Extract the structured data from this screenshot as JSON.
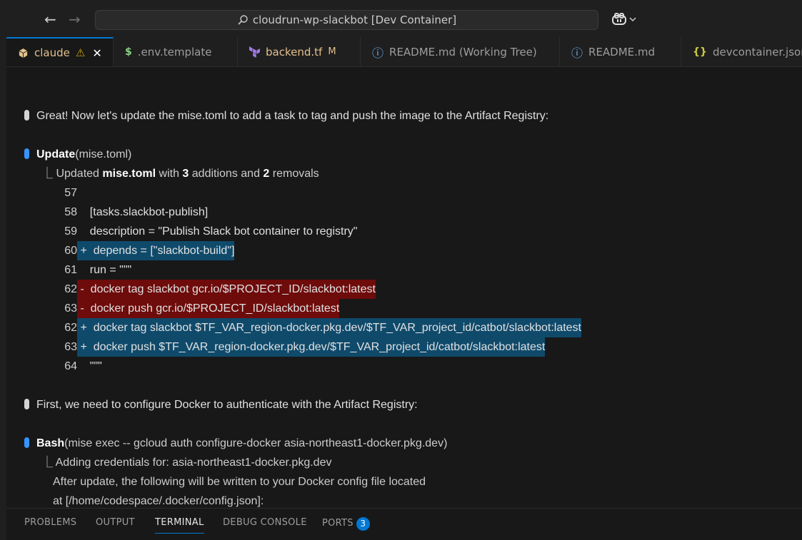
{
  "titlebar": {
    "search_text": "cloudrun-wp-slackbot [Dev Container]",
    "back_icon": "←",
    "forward_icon": "→"
  },
  "tabs": [
    {
      "label": "claude",
      "icon": "cube-icon",
      "warning": "⚠",
      "close": "✕",
      "active": true
    },
    {
      "label": ".env.template",
      "icon": "$"
    },
    {
      "label": "backend.tf",
      "icon": "terraform-icon",
      "badge": "M"
    },
    {
      "label": "README.md (Working Tree)",
      "icon": "ⓘ"
    },
    {
      "label": "README.md",
      "icon": "ⓘ"
    },
    {
      "label": "devcontainer.json",
      "icon": "{}"
    }
  ],
  "terminal": {
    "msg1": "Great! Now let's update the mise.toml to add a task to tag and push the image to the Artifact Registry:",
    "update_tool": "Update",
    "update_arg": "(mise.toml)",
    "updated_prefix": "Updated ",
    "updated_file": "mise.toml",
    "updated_with": " with ",
    "additions": "3",
    "additions_text": " additions and ",
    "removals": "2",
    "removals_text": " removals",
    "diff": [
      {
        "num": "57",
        "sign": " ",
        "text": "",
        "kind": "ctx"
      },
      {
        "num": "58",
        "sign": " ",
        "text": "[tasks.slackbot-publish]",
        "kind": "ctx"
      },
      {
        "num": "59",
        "sign": " ",
        "text": "description = \"Publish Slack bot container to registry\"",
        "kind": "ctx"
      },
      {
        "num": "60",
        "sign": "+",
        "text": "depends = [\"slackbot-build\"]",
        "kind": "add"
      },
      {
        "num": "61",
        "sign": " ",
        "text": "run = \"\"\"",
        "kind": "ctx"
      },
      {
        "num": "62",
        "sign": "-",
        "text": "docker tag slackbot gcr.io/$PROJECT_ID/slackbot:latest",
        "kind": "del"
      },
      {
        "num": "63",
        "sign": "-",
        "text": "docker push gcr.io/$PROJECT_ID/slackbot:latest",
        "kind": "del"
      },
      {
        "num": "62",
        "sign": "+",
        "text": "docker tag slackbot $TF_VAR_region-docker.pkg.dev/$TF_VAR_project_id/catbot/slackbot:latest",
        "kind": "add"
      },
      {
        "num": "63",
        "sign": "+",
        "text": "docker push $TF_VAR_region-docker.pkg.dev/$TF_VAR_project_id/catbot/slackbot:latest",
        "kind": "add"
      },
      {
        "num": "64",
        "sign": " ",
        "text": "\"\"\"",
        "kind": "ctx"
      }
    ],
    "msg2": "First, we need to configure Docker to authenticate with the Artifact Registry:",
    "bash_tool": "Bash",
    "bash_arg": "(mise exec -- gcloud auth configure-docker asia-northeast1-docker.pkg.dev)",
    "out1": "Adding credentials for: asia-northeast1-docker.pkg.dev",
    "out2": "After update, the following will be written to your Docker config file located",
    "out3": "at [/home/codespace/.docker/config.json]:"
  },
  "panel": {
    "problems": "PROBLEMS",
    "output": "OUTPUT",
    "terminal": "TERMINAL",
    "debug_console": "DEBUG CONSOLE",
    "ports": "PORTS",
    "ports_count": "3"
  },
  "colors": {
    "accent": "#0078d4",
    "diff_add_bg": "#0f4a6b",
    "diff_del_bg": "#6e0b0b",
    "tool_dot": "#3794ff",
    "active_tab_text": "#e2c08d"
  }
}
